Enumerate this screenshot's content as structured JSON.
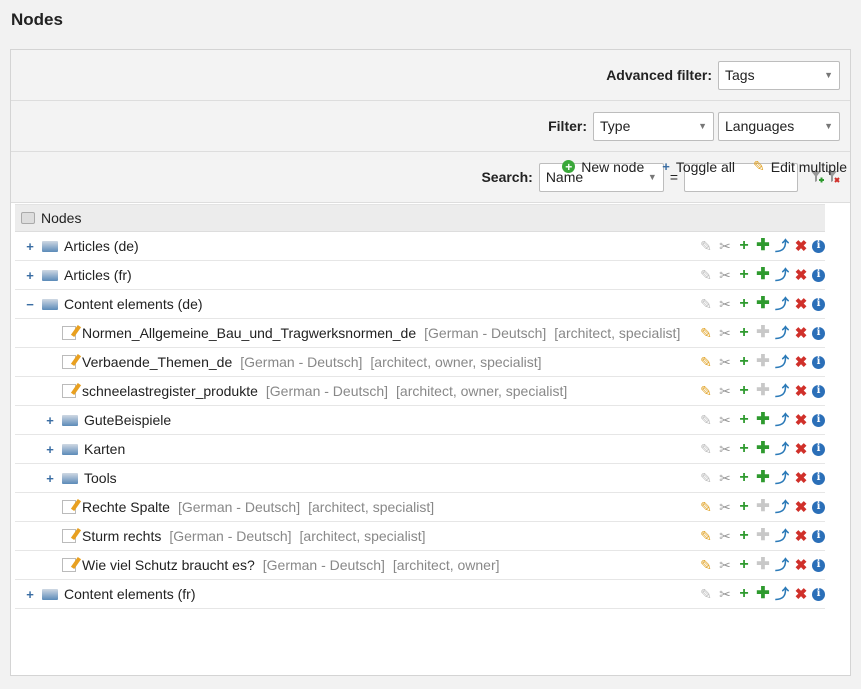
{
  "page": {
    "title": "Nodes"
  },
  "filters": {
    "advanced_label": "Advanced filter:",
    "advanced_value": "Tags",
    "filter_label": "Filter:",
    "type_value": "Type",
    "languages_value": "Languages",
    "search_label": "Search:",
    "search_field_value": "Name",
    "eq": "=",
    "search_value": ""
  },
  "toolbar": {
    "new_node": "New node",
    "toggle_all": "Toggle all",
    "edit_multiple": "Edit multiple"
  },
  "tree": {
    "header": "Nodes",
    "rows": [
      {
        "type": "folder",
        "level": 0,
        "toggle": "+",
        "name": "Articles (de)",
        "lang": "",
        "tags": ""
      },
      {
        "type": "folder",
        "level": 0,
        "toggle": "+",
        "name": "Articles (fr)",
        "lang": "",
        "tags": ""
      },
      {
        "type": "folder",
        "level": 0,
        "toggle": "−",
        "name": "Content elements (de)",
        "lang": "",
        "tags": ""
      },
      {
        "type": "doc",
        "level": 1,
        "toggle": "",
        "name": "Normen_Allgemeine_Bau_und_Tragwerksnormen_de",
        "lang": "[German - Deutsch]",
        "tags": "[architect, specialist]"
      },
      {
        "type": "doc",
        "level": 1,
        "toggle": "",
        "name": "Verbaende_Themen_de",
        "lang": "[German - Deutsch]",
        "tags": "[architect, owner, specialist]"
      },
      {
        "type": "doc",
        "level": 1,
        "toggle": "",
        "name": "schneelastregister_produkte",
        "lang": "[German - Deutsch]",
        "tags": "[architect, owner, specialist]"
      },
      {
        "type": "folder",
        "level": 1,
        "toggle": "+",
        "name": "GuteBeispiele",
        "lang": "",
        "tags": ""
      },
      {
        "type": "folder",
        "level": 1,
        "toggle": "+",
        "name": "Karten",
        "lang": "",
        "tags": ""
      },
      {
        "type": "folder",
        "level": 1,
        "toggle": "+",
        "name": "Tools",
        "lang": "",
        "tags": ""
      },
      {
        "type": "doc",
        "level": 1,
        "toggle": "",
        "name": "Rechte Spalte",
        "lang": "[German - Deutsch]",
        "tags": "[architect, specialist]"
      },
      {
        "type": "doc",
        "level": 1,
        "toggle": "",
        "name": "Sturm rechts",
        "lang": "[German - Deutsch]",
        "tags": "[architect, specialist]"
      },
      {
        "type": "doc",
        "level": 1,
        "toggle": "",
        "name": "Wie viel Schutz braucht es?",
        "lang": "[German - Deutsch]",
        "tags": "[architect, owner]"
      },
      {
        "type": "folder",
        "level": 0,
        "toggle": "+",
        "name": "Content elements (fr)",
        "lang": "",
        "tags": ""
      }
    ]
  },
  "icons": {
    "edit": "pencil-icon",
    "cut": "cut-icon",
    "add": "add-icon",
    "add_child": "add-child-icon",
    "move": "move-icon",
    "delete": "delete-icon",
    "info": "info-icon"
  },
  "colors": {
    "add": "#2e9a2e",
    "delete": "#d0302a",
    "info": "#2b6fb8",
    "edit": "#e0a020"
  }
}
